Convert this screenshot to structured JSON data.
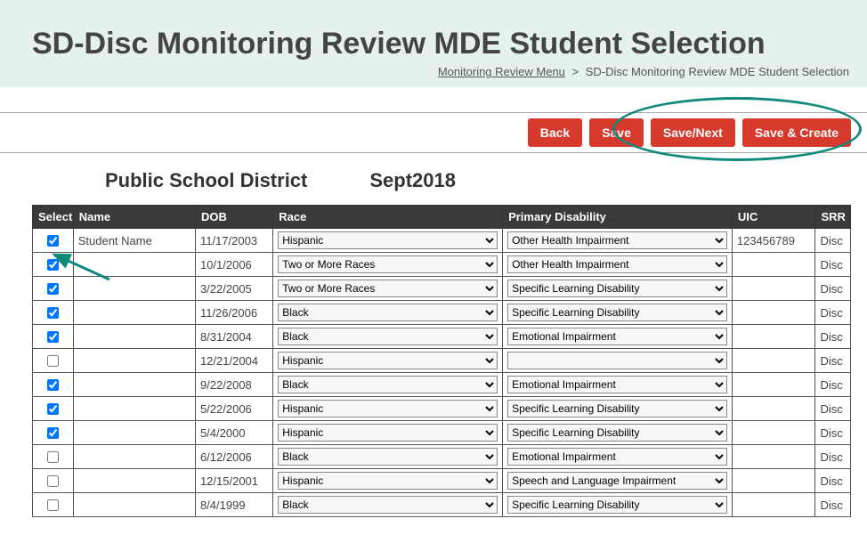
{
  "header": {
    "title": "SD-Disc Monitoring Review MDE Student Selection"
  },
  "breadcrumb": {
    "link_label": "Monitoring Review Menu",
    "sep": ">",
    "current": "SD-Disc Monitoring Review MDE Student Selection"
  },
  "toolbar": {
    "back_label": "Back",
    "save_label": "Save",
    "save_next_label": "Save/Next",
    "save_create_label": "Save & Create"
  },
  "subhead": {
    "district": "Public School District",
    "period": "Sept2018"
  },
  "columns": {
    "select": "Select",
    "name": "Name",
    "dob": "DOB",
    "race": "Race",
    "disability": "Primary Disability",
    "uic": "UIC",
    "srr": "SRR"
  },
  "rows": [
    {
      "selected": true,
      "name": "Student Name",
      "dob": "11/17/2003",
      "race": "Hispanic",
      "disability": "Other Health Impairment",
      "uic": "123456789",
      "srr": "Disc"
    },
    {
      "selected": true,
      "name": "",
      "dob": "10/1/2006",
      "race": "Two or More Races",
      "disability": "Other Health Impairment",
      "uic": "",
      "srr": "Disc"
    },
    {
      "selected": true,
      "name": "",
      "dob": "3/22/2005",
      "race": "Two or More Races",
      "disability": "Specific Learning Disability",
      "uic": "",
      "srr": "Disc"
    },
    {
      "selected": true,
      "name": "",
      "dob": "11/26/2006",
      "race": "Black",
      "disability": "Specific Learning Disability",
      "uic": "",
      "srr": "Disc"
    },
    {
      "selected": true,
      "name": "",
      "dob": "8/31/2004",
      "race": "Black",
      "disability": "Emotional Impairment",
      "uic": "",
      "srr": "Disc"
    },
    {
      "selected": false,
      "name": "",
      "dob": "12/21/2004",
      "race": "Hispanic",
      "disability": "",
      "uic": "",
      "srr": "Disc"
    },
    {
      "selected": true,
      "name": "",
      "dob": "9/22/2008",
      "race": "Black",
      "disability": "Emotional Impairment",
      "uic": "",
      "srr": "Disc"
    },
    {
      "selected": true,
      "name": "",
      "dob": "5/22/2006",
      "race": "Hispanic",
      "disability": "Specific Learning Disability",
      "uic": "",
      "srr": "Disc"
    },
    {
      "selected": true,
      "name": "",
      "dob": "5/4/2000",
      "race": "Hispanic",
      "disability": "Specific Learning Disability",
      "uic": "",
      "srr": "Disc"
    },
    {
      "selected": false,
      "name": "",
      "dob": "6/12/2006",
      "race": "Black",
      "disability": "Emotional Impairment",
      "uic": "",
      "srr": "Disc"
    },
    {
      "selected": false,
      "name": "",
      "dob": "12/15/2001",
      "race": "Hispanic",
      "disability": "Speech and Language Impairment",
      "uic": "",
      "srr": "Disc"
    },
    {
      "selected": false,
      "name": "",
      "dob": "8/4/1999",
      "race": "Black",
      "disability": "Specific Learning Disability",
      "uic": "",
      "srr": "Disc"
    }
  ]
}
